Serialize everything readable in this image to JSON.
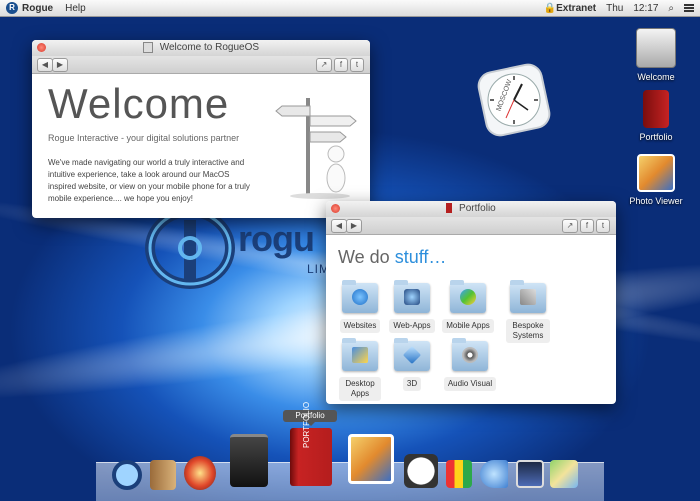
{
  "menubar": {
    "logo_letter": "R",
    "app_name": "Rogue",
    "help": "Help",
    "extranet": "Extranet",
    "day": "Thu",
    "time": "12:17"
  },
  "desktop_icons": [
    {
      "label": "Welcome",
      "icon": "hard-drive-icon"
    },
    {
      "label": "Portfolio",
      "icon": "portfolio-book-icon"
    },
    {
      "label": "Photo Viewer",
      "icon": "photo-viewer-icon"
    }
  ],
  "clock_widget": {
    "city": "MOSCOW"
  },
  "background_brand": {
    "name": "rogu",
    "subtitle": "LIM"
  },
  "welcome_window": {
    "title": "Welcome to RogueOS",
    "heading": "Welcome",
    "subheading": "Rogue Interactive - your digital solutions partner",
    "body": "We've made navigating our world a truly interactive and intuitive experience, take a look around our MacOS inspired website, or view on your mobile phone for a truly mobile experience.... we hope you enjoy!"
  },
  "portfolio_window": {
    "title": "Portfolio",
    "heading_prefix": "We do ",
    "heading_highlight": "stuff…",
    "folders": [
      {
        "label": "Websites",
        "icon": "globe-icon"
      },
      {
        "label": "Web-Apps",
        "icon": "web-apps-icon"
      },
      {
        "label": "Mobile Apps",
        "icon": "mobile-apps-icon"
      },
      {
        "label": "Bespoke Systems",
        "icon": "tools-icon"
      },
      {
        "label": "Desktop Apps",
        "icon": "desktop-apps-icon"
      },
      {
        "label": "3D",
        "icon": "cube-icon"
      },
      {
        "label": "Audio Visual",
        "icon": "audio-visual-icon"
      }
    ]
  },
  "dock": {
    "tooltip": "Portfolio",
    "items": [
      "rogue-logo-icon",
      "address-book-icon",
      "quicktime-icon",
      "shopping-bag-icon",
      "portfolio-book-icon",
      "photo-viewer-icon",
      "clock-icon",
      "rubiks-cube-icon",
      "megaphone-icon",
      "movie-icon",
      "maps-icon"
    ],
    "portfolio_spine_text": "PORTFOLIO"
  },
  "colors": {
    "accent": "#2d8fdc",
    "desktop_blue": "#1552b8",
    "close_red": "#d8382a"
  }
}
